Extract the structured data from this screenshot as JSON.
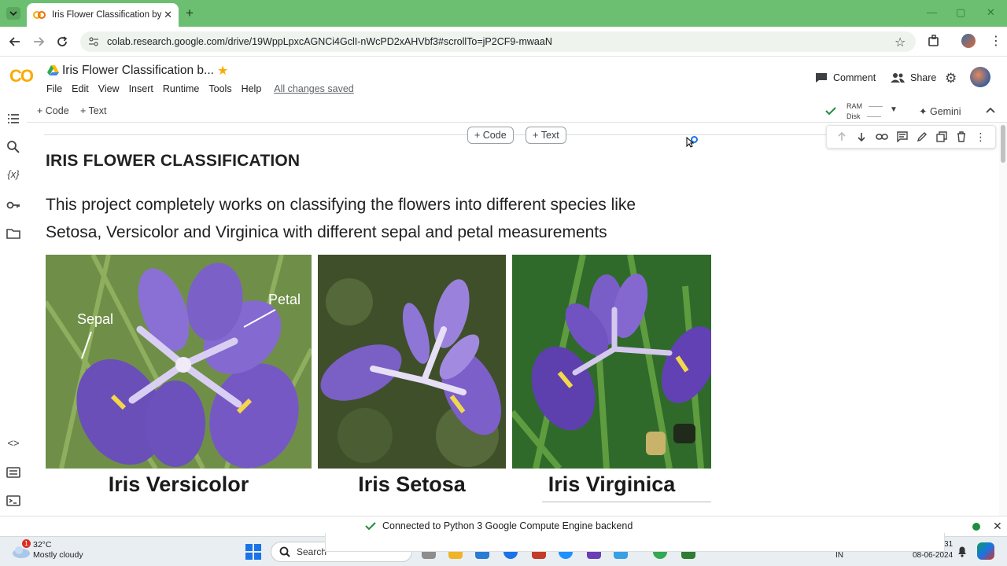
{
  "browser": {
    "tab_title": "Iris Flower Classification by K-N",
    "url": "colab.research.google.com/drive/19WppLpxcAGNCi4GclI-nWcPD2xAHVbf3#scrollTo=jP2CF9-mwaaN"
  },
  "colab": {
    "logo_text": "CO",
    "doc_title": "Iris Flower Classification b...",
    "menus": [
      "File",
      "Edit",
      "View",
      "Insert",
      "Runtime",
      "Tools",
      "Help"
    ],
    "saved_status": "All changes saved",
    "comment_label": "Comment",
    "share_label": "Share",
    "toolbar": {
      "code_label": "Code",
      "text_label": "Text",
      "ram_label": "RAM",
      "disk_label": "Disk",
      "gemini_label": "Gemini"
    }
  },
  "cell": {
    "insert_code_label": "Code",
    "insert_text_label": "Text",
    "heading": "IRIS FLOWER CLASSIFICATION",
    "paragraph_line1": "This project completely works on classifying the flowers into different species like",
    "paragraph_line2": "Setosa, Versicolor and Virginica with different sepal and petal measurements",
    "image_labels": {
      "sepal": "Sepal",
      "petal": "Petal"
    },
    "captions": [
      "Iris Versicolor",
      "Iris Setosa",
      "Iris Virginica"
    ]
  },
  "status": {
    "message": "Connected to Python 3 Google Compute Engine backend"
  },
  "taskbar": {
    "weather_badge": "1",
    "temperature": "32°C",
    "weather": "Mostly cloudy",
    "search_label": "Search",
    "lang": "IN",
    "time_partial": "31",
    "date": "08-06-2024"
  },
  "colors": {
    "tab_strip": "#6cbf70",
    "colab_orange": "#f9ab00",
    "flower_purple": "#7b5cc8",
    "status_green": "#1e8e3e"
  }
}
